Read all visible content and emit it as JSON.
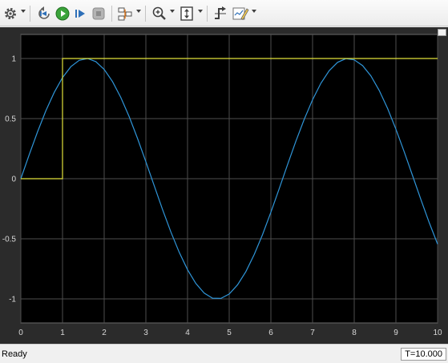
{
  "toolbar": {
    "buttons": [
      {
        "name": "settings-icon"
      },
      {
        "name": "step-back-icon"
      },
      {
        "name": "run-icon"
      },
      {
        "name": "step-forward-icon"
      },
      {
        "name": "stop-icon"
      },
      {
        "name": "signal-layout-icon"
      },
      {
        "name": "zoom-in-icon"
      },
      {
        "name": "autoscale-icon"
      },
      {
        "name": "trigger-icon"
      },
      {
        "name": "highlight-icon"
      }
    ]
  },
  "status": {
    "text": "Ready",
    "time": "T=10.000"
  },
  "colors": {
    "background": "#000000",
    "axis_panel": "#2b2b2b",
    "grid": "#4e4e4e",
    "tick_text": "#d8d8d8",
    "sine": "#2f95d8",
    "step": "#e1e13a"
  },
  "chart_data": {
    "type": "line",
    "xlim": [
      0,
      10
    ],
    "ylim": [
      -1.2,
      1.2
    ],
    "x_ticks": [
      "0",
      "1",
      "2",
      "3",
      "4",
      "5",
      "6",
      "7",
      "8",
      "9",
      "10"
    ],
    "y_ticks": [
      "1",
      "0.5",
      "0",
      "-0.5",
      "-1"
    ],
    "y_tick_values": [
      1,
      0.5,
      0,
      -0.5,
      -1
    ],
    "grid": true,
    "series": [
      {
        "color": "#2f95d8",
        "x": [
          0,
          0.2,
          0.4,
          0.6,
          0.8,
          1.0,
          1.2,
          1.4,
          1.6,
          1.8,
          2.0,
          2.2,
          2.4,
          2.6,
          2.8,
          3.0,
          3.2,
          3.4,
          3.6,
          3.8,
          4.0,
          4.2,
          4.4,
          4.6,
          4.8,
          5.0,
          5.2,
          5.4,
          5.6,
          5.8,
          6.0,
          6.2,
          6.4,
          6.6,
          6.8,
          7.0,
          7.2,
          7.4,
          7.6,
          7.8,
          8.0,
          8.2,
          8.4,
          8.6,
          8.8,
          9.0,
          9.2,
          9.4,
          9.6,
          9.8,
          10.0
        ],
        "y": [
          0,
          0.199,
          0.389,
          0.565,
          0.717,
          0.841,
          0.932,
          0.985,
          1.0,
          0.974,
          0.909,
          0.808,
          0.675,
          0.516,
          0.335,
          0.141,
          -0.058,
          -0.256,
          -0.443,
          -0.612,
          -0.757,
          -0.872,
          -0.952,
          -0.994,
          -0.996,
          -0.959,
          -0.883,
          -0.773,
          -0.631,
          -0.465,
          -0.279,
          -0.083,
          0.117,
          0.312,
          0.494,
          0.657,
          0.794,
          0.899,
          0.968,
          0.999,
          0.989,
          0.941,
          0.855,
          0.734,
          0.585,
          0.412,
          0.223,
          0.025,
          -0.174,
          -0.366,
          -0.544
        ]
      },
      {
        "color": "#e1e13a",
        "x": [
          0,
          1,
          1,
          10
        ],
        "y": [
          0,
          0,
          1,
          1
        ]
      }
    ]
  }
}
